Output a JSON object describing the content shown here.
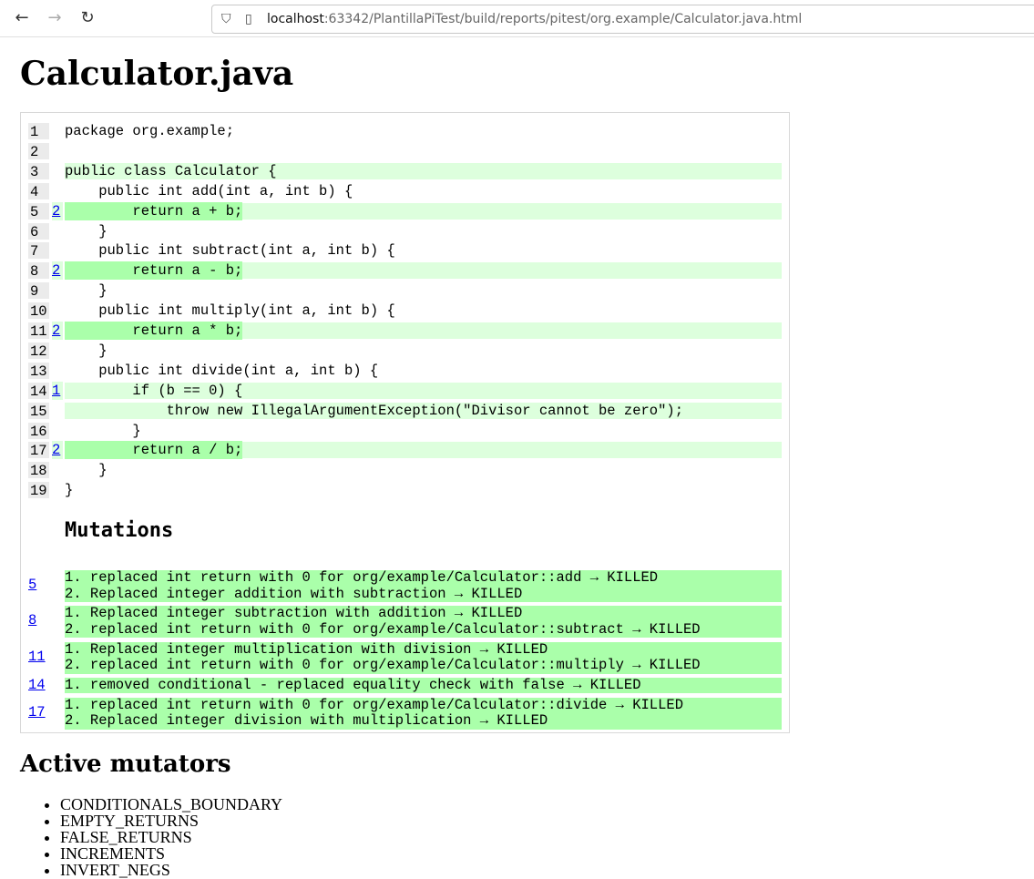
{
  "browser": {
    "url_host": "localhost",
    "url_rest": ":63342/PlantillaPiTest/build/reports/pitest/org.example/Calculator.java.html",
    "icons": {
      "back": "arrow-left-icon",
      "forward": "arrow-right-icon",
      "reload": "reload-icon",
      "security": "shield-icon",
      "page": "page-icon"
    }
  },
  "page_title": "Calculator.java",
  "source_lines": [
    {
      "n": "1",
      "mutations": "",
      "code": "package org.example;",
      "coverage": "none"
    },
    {
      "n": "2",
      "mutations": "",
      "code": "",
      "coverage": "none"
    },
    {
      "n": "3",
      "mutations": "",
      "code": "public class Calculator {",
      "coverage": "covered"
    },
    {
      "n": "4",
      "mutations": "",
      "code": "    public int add(int a, int b) {",
      "coverage": "none"
    },
    {
      "n": "5",
      "mutations": "2",
      "code": "        return a + b;",
      "coverage": "killed"
    },
    {
      "n": "6",
      "mutations": "",
      "code": "    }",
      "coverage": "none"
    },
    {
      "n": "7",
      "mutations": "",
      "code": "    public int subtract(int a, int b) {",
      "coverage": "none"
    },
    {
      "n": "8",
      "mutations": "2",
      "code": "        return a - b;",
      "coverage": "killed"
    },
    {
      "n": "9",
      "mutations": "",
      "code": "    }",
      "coverage": "none"
    },
    {
      "n": "10",
      "mutations": "",
      "code": "    public int multiply(int a, int b) {",
      "coverage": "none"
    },
    {
      "n": "11",
      "mutations": "2",
      "code": "        return a * b;",
      "coverage": "killed"
    },
    {
      "n": "12",
      "mutations": "",
      "code": "    }",
      "coverage": "none"
    },
    {
      "n": "13",
      "mutations": "",
      "code": "    public int divide(int a, int b) {",
      "coverage": "none"
    },
    {
      "n": "14",
      "mutations": "1",
      "code": "        if (b == 0) {",
      "coverage": "covered"
    },
    {
      "n": "15",
      "mutations": "",
      "code": "            throw new IllegalArgumentException(\"Divisor cannot be zero\");",
      "coverage": "covered"
    },
    {
      "n": "16",
      "mutations": "",
      "code": "        }",
      "coverage": "none"
    },
    {
      "n": "17",
      "mutations": "2",
      "code": "        return a / b;",
      "coverage": "killed"
    },
    {
      "n": "18",
      "mutations": "",
      "code": "    }",
      "coverage": "none"
    },
    {
      "n": "19",
      "mutations": "",
      "code": "}",
      "coverage": "none"
    }
  ],
  "mutations_heading": "Mutations",
  "mutation_groups": [
    {
      "line": "5",
      "items": [
        "1. replaced int return with 0 for org/example/Calculator::add → KILLED",
        "2. Replaced integer addition with subtraction → KILLED"
      ]
    },
    {
      "line": "8",
      "items": [
        "1. Replaced integer subtraction with addition → KILLED",
        "2. replaced int return with 0 for org/example/Calculator::subtract → KILLED"
      ]
    },
    {
      "line": "11",
      "items": [
        "1. Replaced integer multiplication with division → KILLED",
        "2. replaced int return with 0 for org/example/Calculator::multiply → KILLED"
      ]
    },
    {
      "line": "14",
      "items": [
        "1. removed conditional - replaced equality check with false → KILLED"
      ]
    },
    {
      "line": "17",
      "items": [
        "1. replaced int return with 0 for org/example/Calculator::divide → KILLED",
        "2. Replaced integer division with multiplication → KILLED"
      ]
    }
  ],
  "active_mutators_heading": "Active mutators",
  "active_mutators": [
    "CONDITIONALS_BOUNDARY",
    "EMPTY_RETURNS",
    "FALSE_RETURNS",
    "INCREMENTS",
    "INVERT_NEGS"
  ],
  "colors": {
    "covered": "#ddffdd",
    "killed": "#aaffaa",
    "link": "#0000ee",
    "line_number_bg": "#ebebeb"
  }
}
